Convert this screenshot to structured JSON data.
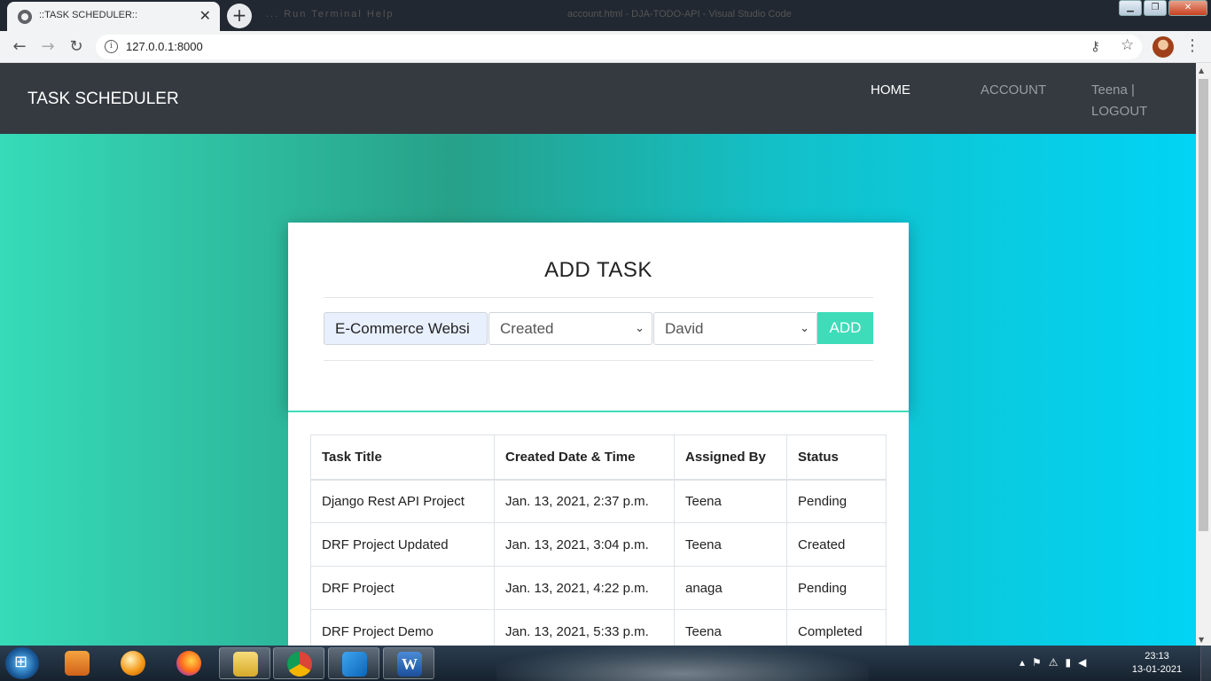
{
  "browser": {
    "tab_title": "::TASK SCHEDULER::",
    "url": "127.0.0.1:8000",
    "background_window_title": "account.html - DJA-TODO-API - Visual Studio Code",
    "background_window_menu": "...  Run  Terminal  Help"
  },
  "navbar": {
    "brand": "TASK SCHEDULER",
    "home": "HOME",
    "account": "ACCOUNT",
    "user": "Teena |",
    "logout": "LOGOUT"
  },
  "form": {
    "heading": "ADD TASK",
    "task_title_value": "E-Commerce Websi",
    "status_selected": "Created",
    "assignee_selected": "David",
    "add_label": "ADD"
  },
  "table": {
    "headers": [
      "Task Title",
      "Created Date & Time",
      "Assigned By",
      "Status"
    ],
    "rows": [
      [
        "Django Rest API Project",
        "Jan. 13, 2021, 2:37 p.m.",
        "Teena",
        "Pending"
      ],
      [
        "DRF Project Updated",
        "Jan. 13, 2021, 3:04 p.m.",
        "Teena",
        "Created"
      ],
      [
        "DRF Project",
        "Jan. 13, 2021, 4:22 p.m.",
        "anaga",
        "Pending"
      ],
      [
        "DRF Project Demo",
        "Jan. 13, 2021, 5:33 p.m.",
        "Teena",
        "Completed"
      ]
    ]
  },
  "taskbar": {
    "time": "23:13",
    "date": "13-01-2021",
    "apps": [
      "media-player-icon",
      "vlc-icon",
      "firefox-icon",
      "file-explorer-icon",
      "chrome-icon",
      "vscode-icon",
      "word-icon"
    ]
  },
  "colors": {
    "accent": "#3edcb9",
    "navbar": "#343a40",
    "gradient_left": "#36dbb8",
    "gradient_right": "#01d4f5"
  }
}
